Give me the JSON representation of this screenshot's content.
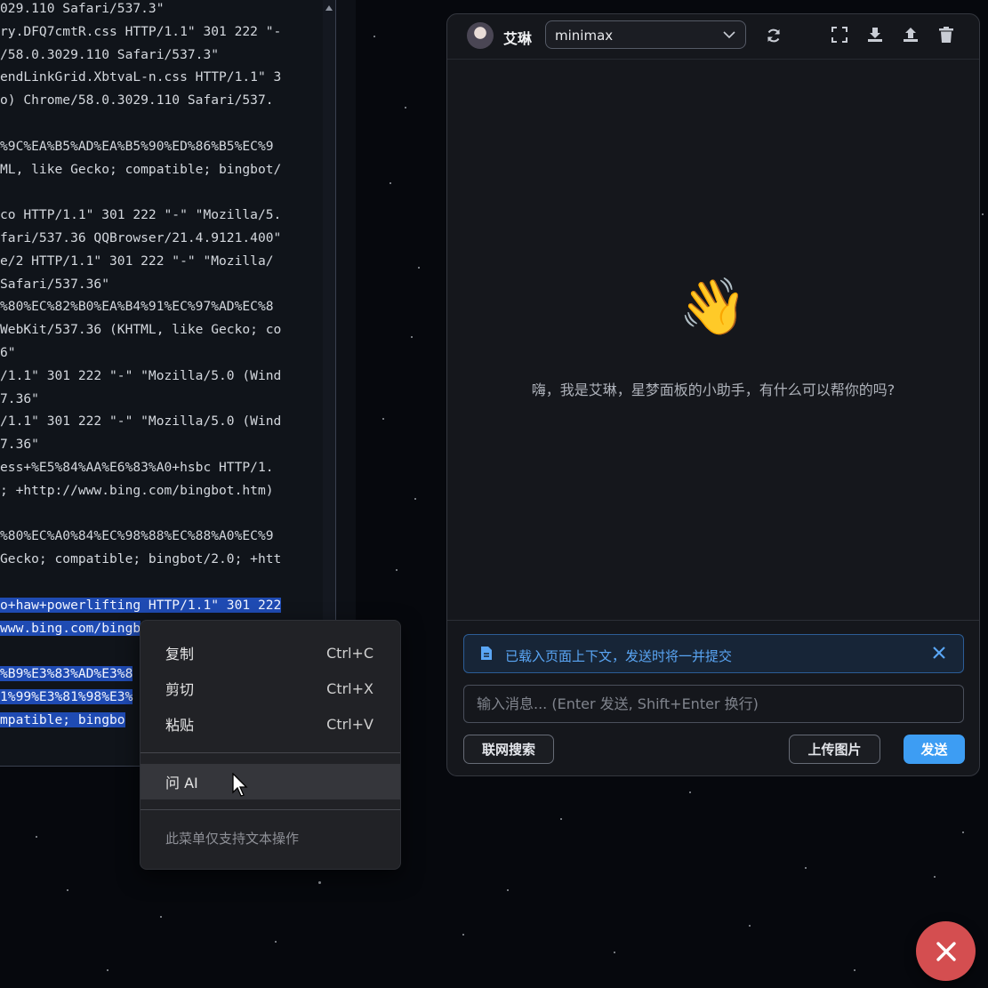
{
  "log": {
    "lines": [
      {
        "text": "029.110 Safari/537.3\"",
        "selected": false
      },
      {
        "text": "ry.DFQ7cmtR.css HTTP/1.1\" 301 222 \"-",
        "selected": false
      },
      {
        "text": "/58.0.3029.110 Safari/537.3\"",
        "selected": false
      },
      {
        "text": "endLinkGrid.XbtvaL-n.css HTTP/1.1\" 3",
        "selected": false
      },
      {
        "text": "o) Chrome/58.0.3029.110 Safari/537.",
        "selected": false
      },
      {
        "text": "",
        "selected": false
      },
      {
        "text": "%9C%EA%B5%AD%EA%B5%90%ED%86%B5%EC%9",
        "selected": false
      },
      {
        "text": "ML, like Gecko; compatible; bingbot/",
        "selected": false
      },
      {
        "text": "",
        "selected": false
      },
      {
        "text": "co HTTP/1.1\" 301 222 \"-\" \"Mozilla/5.",
        "selected": false
      },
      {
        "text": "fari/537.36 QQBrowser/21.4.9121.400\"",
        "selected": false
      },
      {
        "text": "e/2 HTTP/1.1\" 301 222 \"-\" \"Mozilla/",
        "selected": false
      },
      {
        "text": "Safari/537.36\"",
        "selected": false
      },
      {
        "text": "%80%EC%82%B0%EA%B4%91%EC%97%AD%EC%8",
        "selected": false
      },
      {
        "text": "WebKit/537.36 (KHTML, like Gecko; co",
        "selected": false
      },
      {
        "text": "6\"",
        "selected": false
      },
      {
        "text": "/1.1\" 301 222 \"-\" \"Mozilla/5.0 (Wind",
        "selected": false
      },
      {
        "text": "7.36\"",
        "selected": false
      },
      {
        "text": "/1.1\" 301 222 \"-\" \"Mozilla/5.0 (Wind",
        "selected": false
      },
      {
        "text": "7.36\"",
        "selected": false
      },
      {
        "text": "ess+%E5%84%AA%E6%83%A0+hsbc HTTP/1.",
        "selected": false
      },
      {
        "text": "; +http://www.bing.com/bingbot.htm)",
        "selected": false
      },
      {
        "text": "",
        "selected": false
      },
      {
        "text": "%80%EC%A0%84%EC%98%88%EC%88%A0%EC%9",
        "selected": false
      },
      {
        "text": "Gecko; compatible; bingbot/2.0; +htt",
        "selected": false
      },
      {
        "text": "",
        "selected": false
      },
      {
        "text": "o+haw+powerlifting HTTP/1.1\" 301 222",
        "selected": true
      },
      {
        "text": "www.bing.com/bingb",
        "selected": true
      },
      {
        "text": "",
        "selected": false
      },
      {
        "text": "%B9%E3%83%AD%E3%8",
        "selected": true
      },
      {
        "text": "1%99%E3%81%98%E3%",
        "selected": true
      },
      {
        "text": "mpatible; bingbo",
        "selected": true
      }
    ]
  },
  "context_menu": {
    "items": [
      {
        "label": "复制",
        "shortcut": "Ctrl+C"
      },
      {
        "label": "剪切",
        "shortcut": "Ctrl+X"
      },
      {
        "label": "粘贴",
        "shortcut": "Ctrl+V"
      }
    ],
    "ask_ai": "问 AI",
    "note": "此菜单仅支持文本操作"
  },
  "chat": {
    "bot_name": "艾琳",
    "model": "minimax",
    "welcome_emoji": "👋",
    "welcome_text": "嗨，我是艾琳，星梦面板的小助手，有什么可以帮你的吗?",
    "context_notice": "已载入页面上下文，发送时将一并提交",
    "input_placeholder": "输入消息... (Enter 发送, Shift+Enter 换行)",
    "input_value": "",
    "web_search_label": "联网搜索",
    "upload_image_label": "上传图片",
    "send_label": "发送"
  },
  "colors": {
    "accent": "#3d9df3",
    "selection": "#1f4bb3",
    "close_fab": "#d44e50",
    "notice_text": "#5aa6f5"
  },
  "icons": {
    "refresh": "refresh-icon",
    "fullscreen": "fullscreen-icon",
    "download": "download-icon",
    "upload": "upload-icon",
    "trash": "trash-icon",
    "close": "close-icon"
  }
}
